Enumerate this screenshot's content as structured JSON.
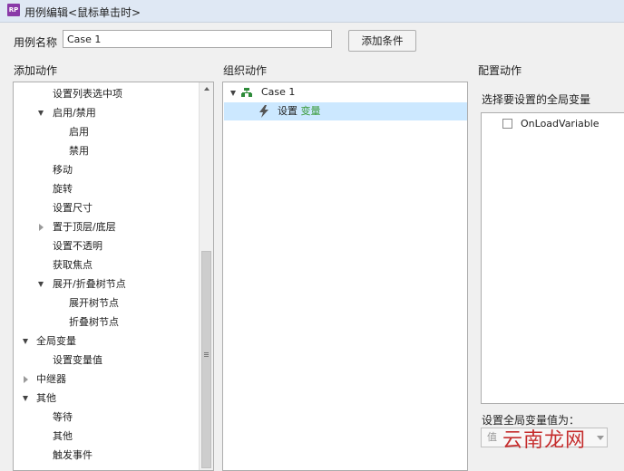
{
  "window": {
    "title": "用例编辑<鼠标单击时>",
    "app_icon_text": "RP"
  },
  "case_name": {
    "label": "用例名称",
    "value": "Case 1"
  },
  "add_condition_label": "添加条件",
  "sections": {
    "add_action": "添加动作",
    "organize_action": "组织动作",
    "configure_action": "配置动作"
  },
  "action_tree": [
    {
      "label": "设置列表选中项",
      "level": 2,
      "toggle": "none"
    },
    {
      "label": "启用/禁用",
      "level": 2,
      "toggle": "open"
    },
    {
      "label": "启用",
      "level": 3,
      "toggle": "none"
    },
    {
      "label": "禁用",
      "level": 3,
      "toggle": "none"
    },
    {
      "label": "移动",
      "level": 2,
      "toggle": "none"
    },
    {
      "label": "旋转",
      "level": 2,
      "toggle": "none"
    },
    {
      "label": "设置尺寸",
      "level": 2,
      "toggle": "none"
    },
    {
      "label": "置于顶层/底层",
      "level": 2,
      "toggle": "closed"
    },
    {
      "label": "设置不透明",
      "level": 2,
      "toggle": "none"
    },
    {
      "label": "获取焦点",
      "level": 2,
      "toggle": "none"
    },
    {
      "label": "展开/折叠树节点",
      "level": 2,
      "toggle": "open"
    },
    {
      "label": "展开树节点",
      "level": 3,
      "toggle": "none"
    },
    {
      "label": "折叠树节点",
      "level": 3,
      "toggle": "none"
    },
    {
      "label": "全局变量",
      "level": 1,
      "toggle": "open"
    },
    {
      "label": "设置变量值",
      "level": 2,
      "toggle": "none"
    },
    {
      "label": "中继器",
      "level": 1,
      "toggle": "closed"
    },
    {
      "label": "其他",
      "level": 1,
      "toggle": "open"
    },
    {
      "label": "等待",
      "level": 2,
      "toggle": "none"
    },
    {
      "label": "其他",
      "level": 2,
      "toggle": "none"
    },
    {
      "label": "触发事件",
      "level": 2,
      "toggle": "none"
    }
  ],
  "organize": {
    "case_label": "Case 1",
    "action_prefix": "设置",
    "action_target": "变量"
  },
  "configure": {
    "select_label": "选择要设置的全局变量",
    "variables": [
      {
        "name": "OnLoadVariable",
        "checked": false
      }
    ],
    "set_value_label": "设置全局变量值为：",
    "value_type": "值"
  },
  "watermark": "云南龙网",
  "colors": {
    "selection": "#cce8ff",
    "action_target": "#3a9a3a",
    "case_icon": "#2e8b3a",
    "app_icon": "#8a3aa8"
  }
}
